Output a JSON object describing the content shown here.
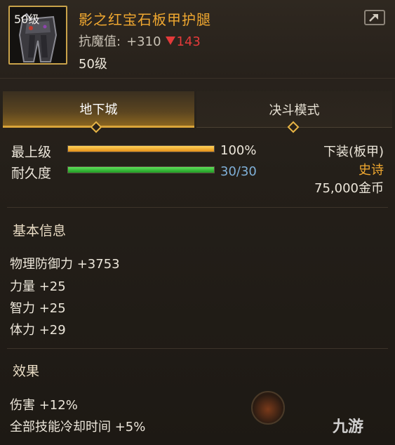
{
  "item": {
    "level_tag": "50级",
    "name": "影之红宝石板甲护腿",
    "anti_magic_label": "抗魔值:",
    "anti_magic_value": "+310",
    "anti_magic_diff": "143",
    "level_line": "50级",
    "icon": "armor-leggings-icon",
    "share_icon": "share-icon"
  },
  "tabs": [
    {
      "label": "地下城",
      "active": true
    },
    {
      "label": "决斗模式",
      "active": false
    }
  ],
  "stats": {
    "max_level_label": "最上级",
    "max_level_value": "100%",
    "max_level_fraction": 1.0,
    "durability_label": "耐久度",
    "durability_value": "30/30",
    "durability_fraction": 1.0
  },
  "right_info": {
    "slot_type": "下装(板甲)",
    "rarity": "史诗",
    "price": "75,000金币"
  },
  "basic_info": {
    "title": "基本信息",
    "attributes": [
      "物理防御力 +3753",
      "力量 +25",
      "智力 +25",
      "体力 +29"
    ]
  },
  "effects": {
    "title": "效果",
    "lines": [
      "伤害 +12%",
      "全部技能冷却时间 +5%"
    ]
  },
  "colors": {
    "name": "#f0a830",
    "rarity": "#f0a830",
    "diff_down": "#e43a3a",
    "durability": "#7fb0d8"
  },
  "watermark": "九游"
}
